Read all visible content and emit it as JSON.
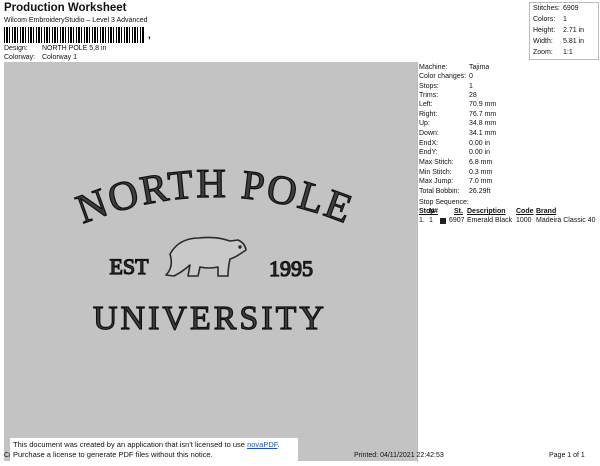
{
  "header": {
    "title": "Production Worksheet",
    "subtitle": "Wilcom EmbroideryStudio – Level 3 Advanced",
    "barcode_suffix": ",",
    "design_label": "Design:",
    "design_value": "NORTH POLE 5,8 in",
    "colorway_label": "Colorway:",
    "colorway_value": "Colorway 1"
  },
  "summary": [
    {
      "label": "Stitches:",
      "value": "6909"
    },
    {
      "label": "Colors:",
      "value": "1"
    },
    {
      "label": "Height:",
      "value": "2.71 in"
    },
    {
      "label": "Width:",
      "value": "5.81 in"
    },
    {
      "label": "Zoom:",
      "value": "1:1"
    }
  ],
  "design_preview": {
    "line1": "NORTH POLE",
    "line2_left": "EST",
    "line2_right": "1995",
    "line3": "UNIVERSITY",
    "thread_color": "#3b3f3d",
    "background_color": "#c3c3c3"
  },
  "machine_info": [
    {
      "label": "Machine:",
      "value": "Tajima"
    },
    {
      "label": "Color changes:",
      "value": "0"
    },
    {
      "label": "Stops:",
      "value": "1"
    },
    {
      "label": "Trims:",
      "value": "28"
    },
    {
      "label": "Left:",
      "value": "70.9 mm"
    },
    {
      "label": "Right:",
      "value": "76.7 mm"
    },
    {
      "label": "Up:",
      "value": "34.8 mm"
    },
    {
      "label": "Down:",
      "value": "34.1 mm"
    },
    {
      "label": "EndX:",
      "value": "0.00 in"
    },
    {
      "label": "EndY:",
      "value": "0.00 in"
    },
    {
      "label": "Max Stitch:",
      "value": "6.8 mm"
    },
    {
      "label": "Min Stitch:",
      "value": "0.3 mm"
    },
    {
      "label": "Max Jump:",
      "value": "7.0 mm"
    },
    {
      "label": "Total Bobbin:",
      "value": "26.29ft"
    }
  ],
  "stop_sequence": {
    "title": "Stop Sequence:",
    "columns": {
      "stop": "Stop",
      "num": "N#",
      "st": "St.",
      "description": "Description",
      "code": "Code",
      "brand": "Brand"
    },
    "rows": [
      {
        "stop": "1.",
        "num": "1",
        "st": "6907",
        "description": "Emerald Black",
        "code": "1000",
        "brand": "Madeira Classic 40",
        "color": "#222222"
      }
    ]
  },
  "notice": {
    "line1_prefix": "This document was created by an application that isn't licensed to use ",
    "link": "novaPDF",
    "line1_suffix": ".",
    "line2": "Purchase a license to generate PDF files without this notice."
  },
  "footer": {
    "left": "Cr",
    "printed": "Printed: 04/11/2021 22:42:53",
    "page": "Page 1 of 1"
  }
}
